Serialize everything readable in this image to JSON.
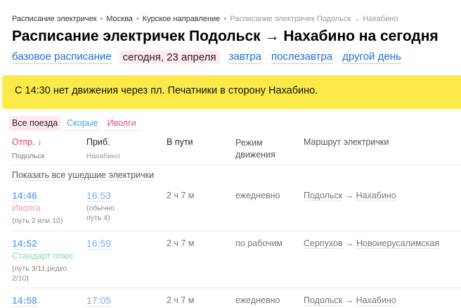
{
  "breadcrumbs": [
    "Расписание электричек",
    "Москва",
    "Курское направление",
    "Расписание электричек Подольск → Нахабино"
  ],
  "title": "Расписание электричек Подольск → Нахабино на сегодня",
  "days": {
    "base": "базовое расписание",
    "today": "сегодня, 23 апреля",
    "tomorrow": "завтра",
    "after": "послезавтра",
    "other": "другой день"
  },
  "banner": "С 14:30 нет движения через пл. Печатники в сторону Нахабино.",
  "filters": {
    "all": "Все поезда",
    "fast": "Скорые",
    "ivolga": "Иволги"
  },
  "headers": {
    "dep": "Отпр. ↓",
    "dep_sub": "Подольск",
    "arr": "Приб.",
    "arr_sub": "Нахабино",
    "travel": "В пути",
    "mode": "Режим движения",
    "route": "Маршрут электрички"
  },
  "show_departed": "Показать все ушедшие электрички",
  "rows": [
    {
      "dep": "14:46",
      "type": "Иволга",
      "type_color": "#f29ab8",
      "dep_note": "(путь 2 или 10)",
      "arr": "16:53",
      "arr_note": "(обычно путь 4)",
      "travel": "2 ч 7 м",
      "mode": "ежедневно",
      "from": "Подольск",
      "to": "Нахабино"
    },
    {
      "dep": "14:52",
      "type": "Стандарт плюс",
      "type_color": "#8fd9b4",
      "dep_note": "(путь 3/11,редко 2/10)",
      "arr": "16:59",
      "arr_note": "",
      "travel": "2 ч 7 м",
      "mode": "по рабочим",
      "from": "Серпухов",
      "to": "Новоиерусалимская"
    },
    {
      "dep": "14:58",
      "type": "",
      "type_color": "",
      "dep_note": "",
      "arr": "17:05",
      "arr_note": "",
      "travel": "2 ч 7 м",
      "mode": "ежедневно",
      "from": "Подольск",
      "to": "Нахабино"
    }
  ]
}
